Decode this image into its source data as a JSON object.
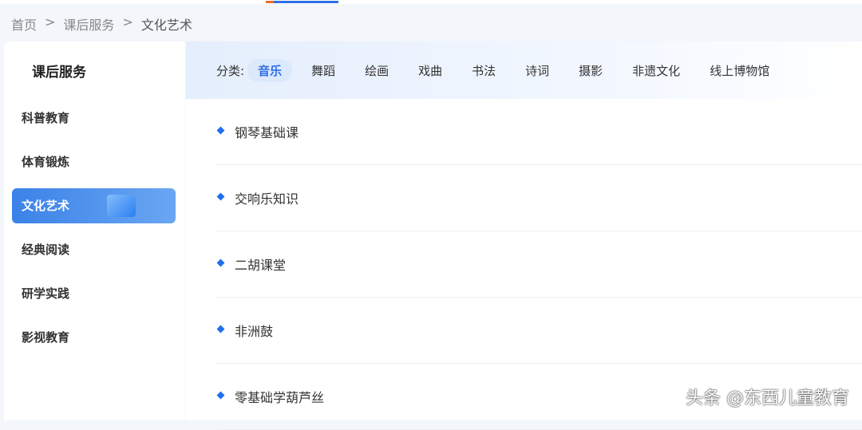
{
  "breadcrumb": [
    "首页",
    ">",
    "课后服务",
    ">",
    "文化艺术"
  ],
  "sidebar": {
    "title": "课后服务",
    "items": [
      {
        "label": "科普教育"
      },
      {
        "label": "体育锻炼"
      },
      {
        "label": "文化艺术",
        "active": true
      },
      {
        "label": "经典阅读"
      },
      {
        "label": "研学实践"
      },
      {
        "label": "影视教育"
      }
    ]
  },
  "filter": {
    "label": "分类:",
    "categories": [
      "音乐",
      "舞蹈",
      "绘画",
      "戏曲",
      "书法",
      "诗词",
      "摄影",
      "非遗文化",
      "线上博物馆"
    ]
  },
  "courses": [
    "钢琴基础课",
    "交响乐知识",
    "二胡课堂",
    "非洲鼓",
    "零基础学葫芦丝"
  ],
  "watermark": "头条 @东西儿童教育",
  "colors": {
    "accent": "#2f6fe6"
  }
}
